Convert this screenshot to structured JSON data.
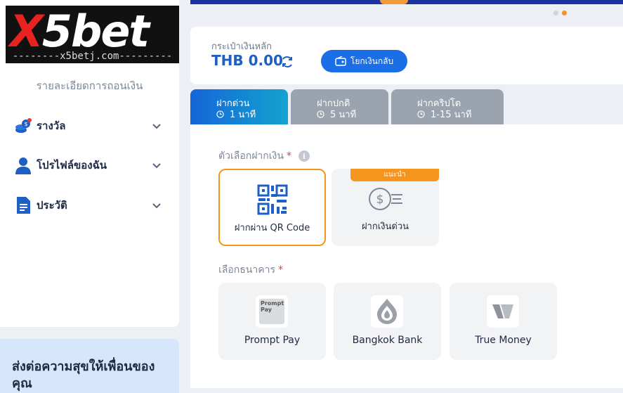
{
  "brand": {
    "logo_text_x": "X",
    "logo_text_rest": "5bet",
    "domain": "--------x5betj.com---------"
  },
  "sidebar": {
    "subtitle": "รายละเอียดการถอนเงิน",
    "items": [
      {
        "label": "รางวัล",
        "icon": "coins-icon"
      },
      {
        "label": "โปรไฟล์ของฉัน",
        "icon": "user-icon"
      },
      {
        "label": "ประวัติ",
        "icon": "document-icon"
      }
    ]
  },
  "promo": {
    "text": "ส่งต่อความสุขให้เพื่อนของคุณ"
  },
  "carousel": {
    "total": 2,
    "active_index": 1
  },
  "wallet": {
    "label": "กระเป๋าเงินหลัก",
    "balance": "THB 0.00",
    "transfer_button": "โยกเงินกลับ"
  },
  "tabs": [
    {
      "name": "ฝากด่วน",
      "time": "1 นาที",
      "active": true
    },
    {
      "name": "ฝากปกติ",
      "time": "5 นาที",
      "active": false
    },
    {
      "name": "ฝากคริปโต",
      "time": "1-15 นาที",
      "active": false
    }
  ],
  "deposit_options": {
    "label": "ตัวเลือกฝากเงิน",
    "required_mark": "*",
    "info_icon": "i",
    "options": [
      {
        "label": "ฝากผ่าน QR Code",
        "selected": true
      },
      {
        "label": "ฝากเงินด่วน",
        "selected": false,
        "badge": "แนะนำ"
      }
    ]
  },
  "banks": {
    "label": "เลือกธนาคาร",
    "required_mark": "*",
    "items": [
      {
        "name": "Prompt Pay",
        "logo_text_1": "Prompt",
        "logo_text_2": "Pay"
      },
      {
        "name": "Bangkok Bank"
      },
      {
        "name": "True Money"
      }
    ]
  },
  "colors": {
    "accent": "#1a6ee6",
    "selected_border": "#f5951e",
    "required": "#e23b3b"
  }
}
